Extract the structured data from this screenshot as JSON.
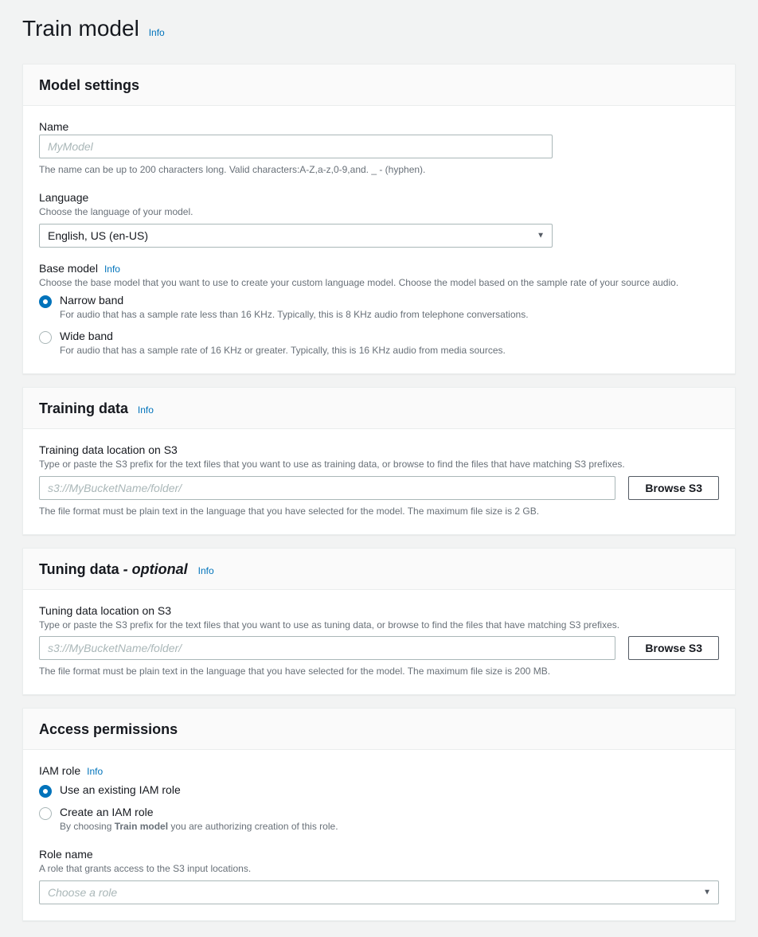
{
  "header": {
    "title": "Train model",
    "info": "Info"
  },
  "modelSettings": {
    "title": "Model settings",
    "name": {
      "label": "Name",
      "placeholder": "MyModel",
      "hint": "The name can be up to 200 characters long. Valid characters:A-Z,a-z,0-9,and. _ - (hyphen)."
    },
    "language": {
      "label": "Language",
      "desc": "Choose the language of your model.",
      "value": "English, US (en-US)"
    },
    "baseModel": {
      "label": "Base model",
      "info": "Info",
      "desc": "Choose the base model that you want to use to create your custom language model. Choose the model based on the sample rate of your source audio.",
      "options": [
        {
          "label": "Narrow band",
          "desc": "For audio that has a sample rate less than 16 KHz. Typically, this is 8 KHz audio from telephone conversations.",
          "selected": true
        },
        {
          "label": "Wide band",
          "desc": "For audio that has a sample rate of 16 KHz or greater. Typically, this is 16 KHz audio from media sources.",
          "selected": false
        }
      ]
    }
  },
  "trainingData": {
    "title": "Training data",
    "info": "Info",
    "location": {
      "label": "Training data location on S3",
      "desc": "Type or paste the S3 prefix for the text files that you want to use as training data, or browse to find the files that have matching S3 prefixes.",
      "placeholder": "s3://MyBucketName/folder/",
      "browse": "Browse S3",
      "hint": "The file format must be plain text in the language that you have selected for the model. The maximum file size is 2 GB."
    }
  },
  "tuningData": {
    "title": "Tuning data",
    "optional": " - optional",
    "info": "Info",
    "location": {
      "label": "Tuning data location on S3",
      "desc": "Type or paste the S3 prefix for the text files that you want to use as tuning data, or browse to find the files that have matching S3 prefixes.",
      "placeholder": "s3://MyBucketName/folder/",
      "browse": "Browse S3",
      "hint": "The file format must be plain text in the language that you have selected for the model. The maximum file size is 200 MB."
    }
  },
  "accessPermissions": {
    "title": "Access permissions",
    "iamRole": {
      "label": "IAM role",
      "info": "Info",
      "options": [
        {
          "label": "Use an existing IAM role",
          "selected": true
        },
        {
          "label": "Create an IAM role",
          "descPrefix": "By choosing ",
          "descBold": "Train model",
          "descSuffix": " you are authorizing creation of this role.",
          "selected": false
        }
      ]
    },
    "roleName": {
      "label": "Role name",
      "desc": "A role that grants access to the S3 input locations.",
      "placeholder": "Choose a role"
    }
  }
}
